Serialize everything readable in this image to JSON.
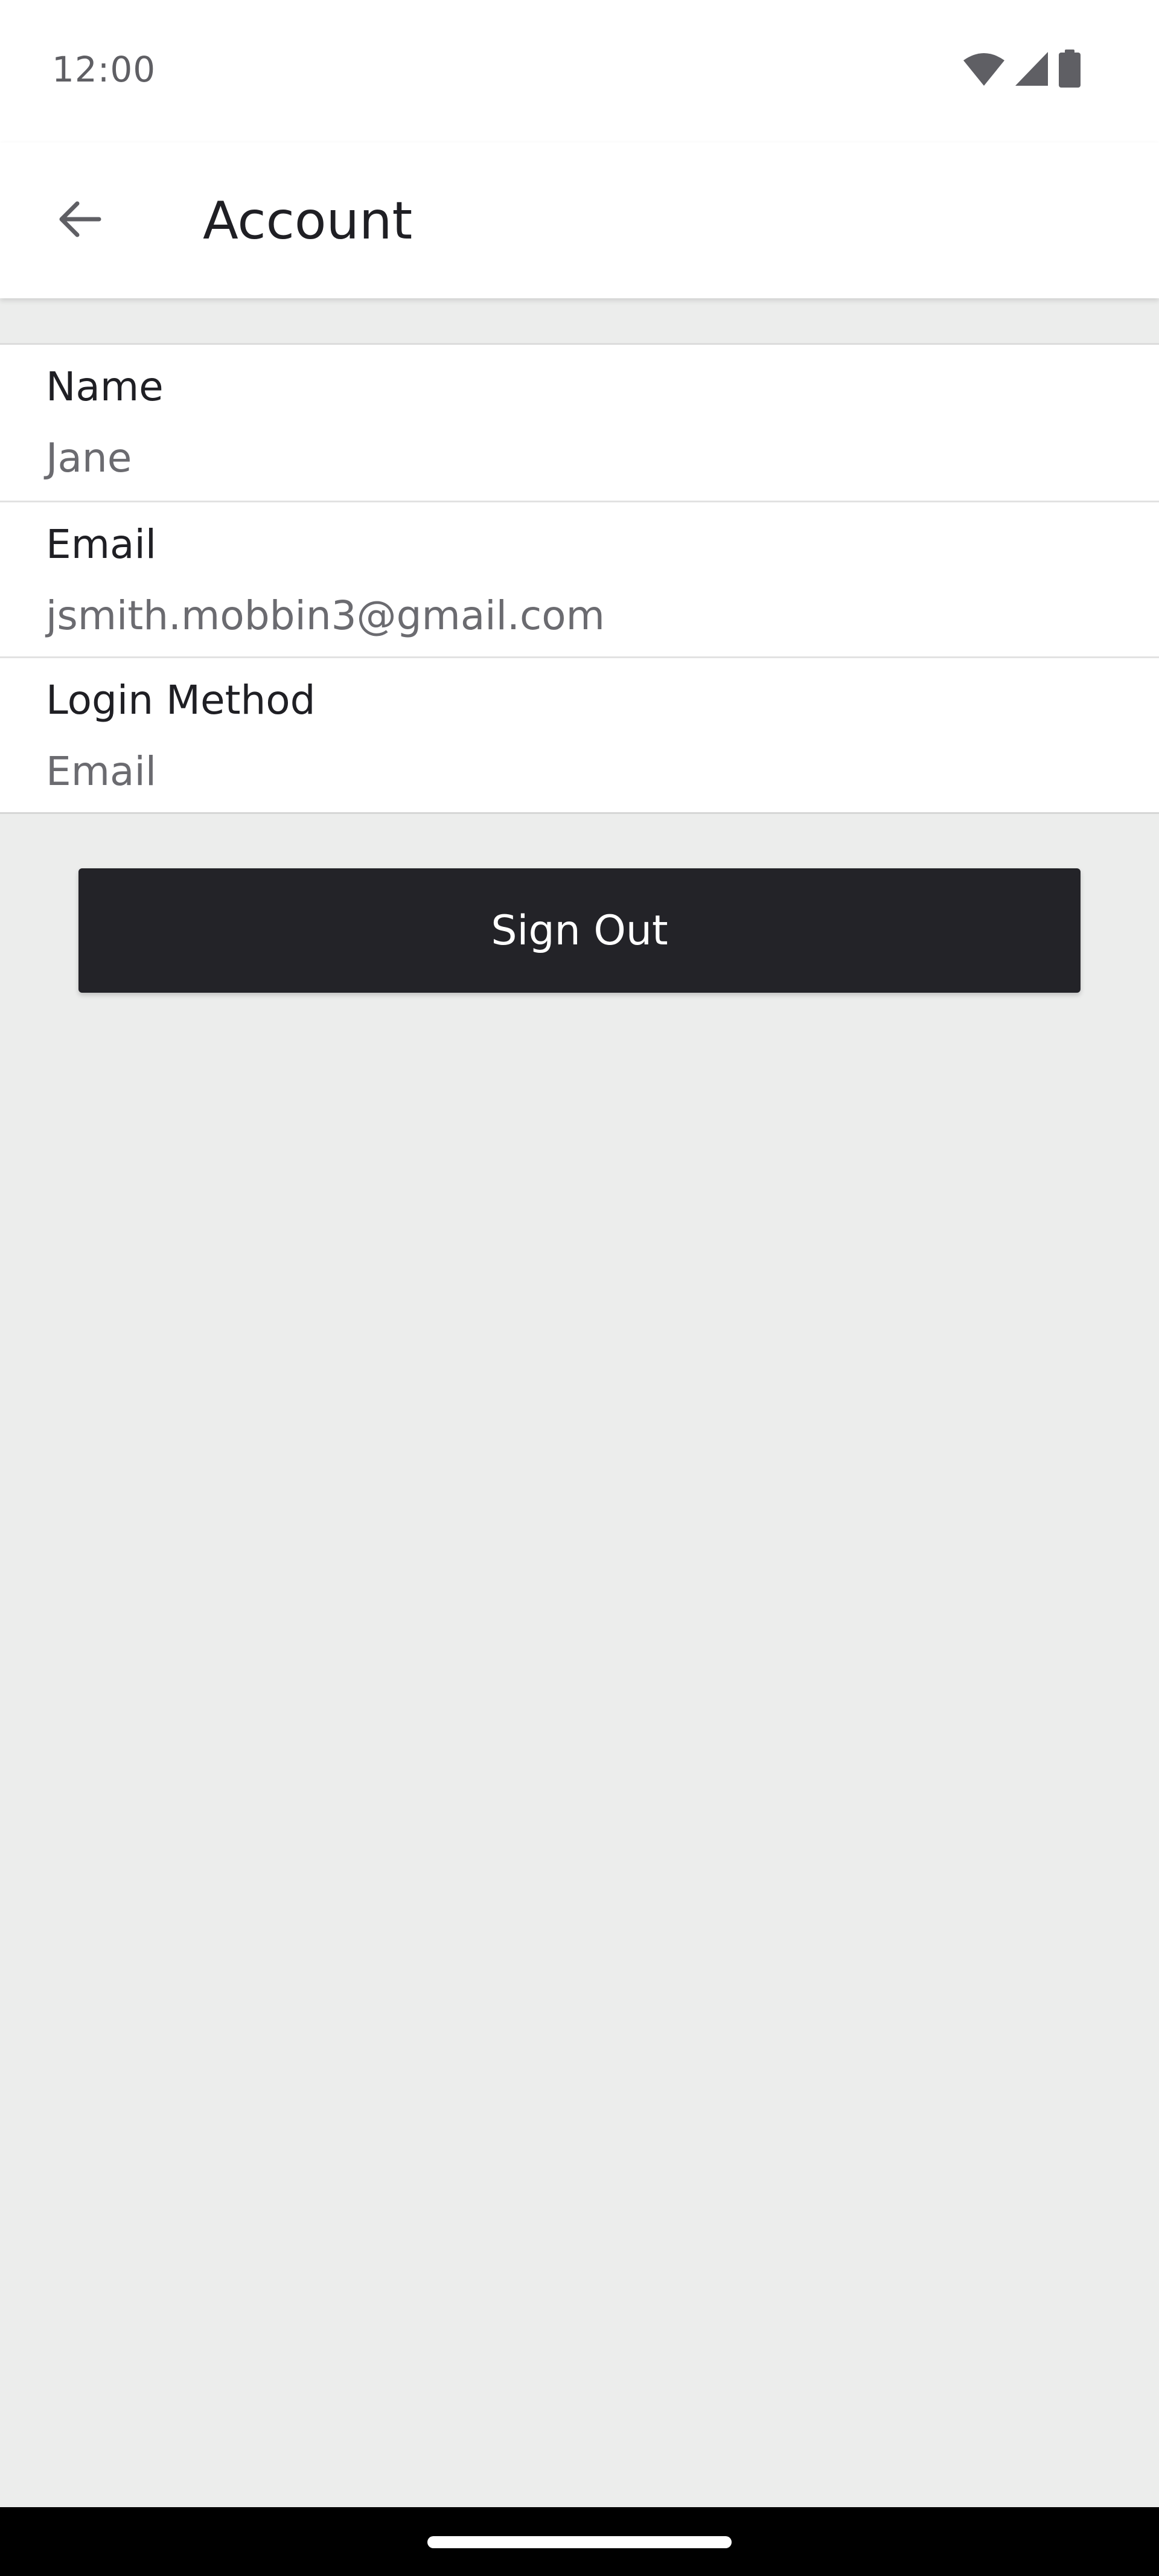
{
  "status_bar": {
    "time": "12:00",
    "icons": [
      "wifi-icon",
      "cell-signal-icon",
      "battery-icon"
    ]
  },
  "app_bar": {
    "back_icon": "arrow-left-icon",
    "title": "Account"
  },
  "account": {
    "rows": [
      {
        "label": "Name",
        "value": "Jane"
      },
      {
        "label": "Email",
        "value": "jsmith.mobbin3@gmail.com"
      },
      {
        "label": "Login Method",
        "value": "Email"
      }
    ]
  },
  "actions": {
    "sign_out_label": "Sign Out"
  },
  "colors": {
    "background": "#ECEDEC",
    "surface": "#FFFFFF",
    "button": "#232328",
    "text_primary": "#1F1F24",
    "text_secondary": "#6B6B70"
  }
}
